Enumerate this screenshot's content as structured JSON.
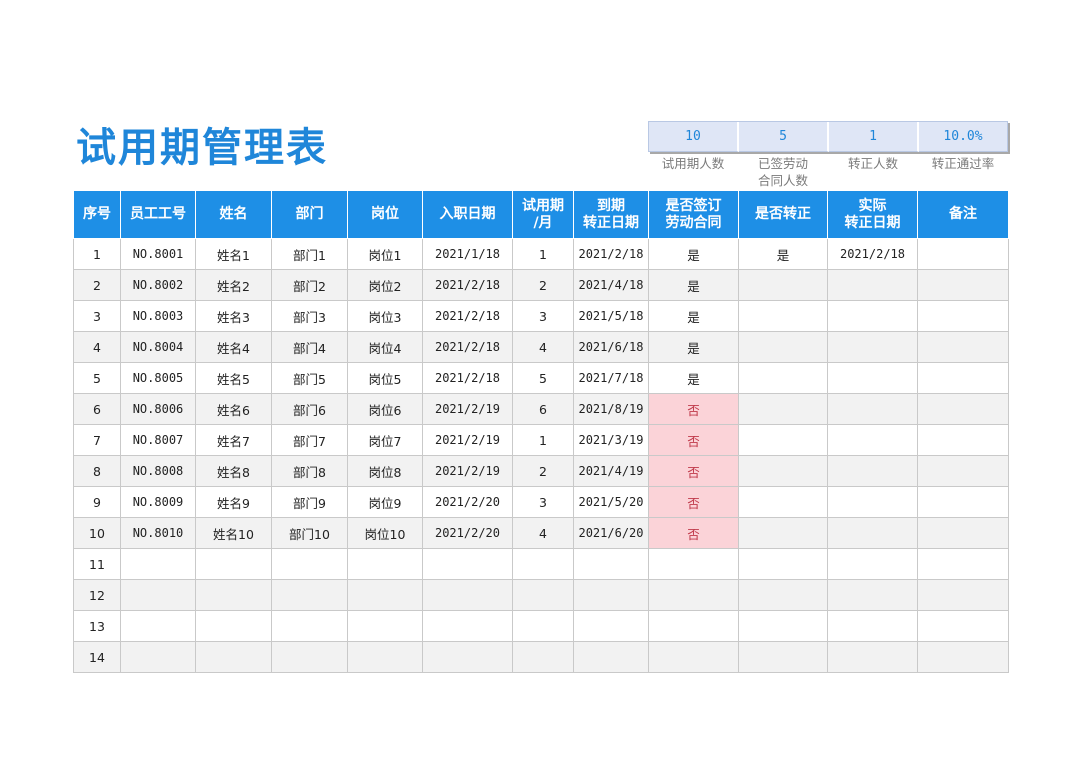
{
  "title": "试用期管理表",
  "stats": [
    {
      "value": "10",
      "label": "试用期人数"
    },
    {
      "value": "5",
      "label": "已签劳动\n合同人数"
    },
    {
      "value": "1",
      "label": "转正人数"
    },
    {
      "value": "10.0%",
      "label": "转正通过率"
    }
  ],
  "table": {
    "headers": [
      "序号",
      "员工工号",
      "姓名",
      "部门",
      "岗位",
      "入职日期",
      "试用期\n/月",
      "到期\n转正日期",
      "是否签订\n劳动合同",
      "是否转正",
      "实际\n转正日期",
      "备注"
    ],
    "rows": [
      [
        "1",
        "NO.8001",
        "姓名1",
        "部门1",
        "岗位1",
        "2021/1/18",
        "1",
        "2021/2/18",
        "是",
        "是",
        "2021/2/18",
        ""
      ],
      [
        "2",
        "NO.8002",
        "姓名2",
        "部门2",
        "岗位2",
        "2021/2/18",
        "2",
        "2021/4/18",
        "是",
        "",
        "",
        ""
      ],
      [
        "3",
        "NO.8003",
        "姓名3",
        "部门3",
        "岗位3",
        "2021/2/18",
        "3",
        "2021/5/18",
        "是",
        "",
        "",
        ""
      ],
      [
        "4",
        "NO.8004",
        "姓名4",
        "部门4",
        "岗位4",
        "2021/2/18",
        "4",
        "2021/6/18",
        "是",
        "",
        "",
        ""
      ],
      [
        "5",
        "NO.8005",
        "姓名5",
        "部门5",
        "岗位5",
        "2021/2/18",
        "5",
        "2021/7/18",
        "是",
        "",
        "",
        ""
      ],
      [
        "6",
        "NO.8006",
        "姓名6",
        "部门6",
        "岗位6",
        "2021/2/19",
        "6",
        "2021/8/19",
        "否",
        "",
        "",
        ""
      ],
      [
        "7",
        "NO.8007",
        "姓名7",
        "部门7",
        "岗位7",
        "2021/2/19",
        "1",
        "2021/3/19",
        "否",
        "",
        "",
        ""
      ],
      [
        "8",
        "NO.8008",
        "姓名8",
        "部门8",
        "岗位8",
        "2021/2/19",
        "2",
        "2021/4/19",
        "否",
        "",
        "",
        ""
      ],
      [
        "9",
        "NO.8009",
        "姓名9",
        "部门9",
        "岗位9",
        "2021/2/20",
        "3",
        "2021/5/20",
        "否",
        "",
        "",
        ""
      ],
      [
        "10",
        "NO.8010",
        "姓名10",
        "部门10",
        "岗位10",
        "2021/2/20",
        "4",
        "2021/6/20",
        "否",
        "",
        "",
        ""
      ],
      [
        "11",
        "",
        "",
        "",
        "",
        "",
        "",
        "",
        "",
        "",
        "",
        ""
      ],
      [
        "12",
        "",
        "",
        "",
        "",
        "",
        "",
        "",
        "",
        "",
        "",
        ""
      ],
      [
        "13",
        "",
        "",
        "",
        "",
        "",
        "",
        "",
        "",
        "",
        "",
        ""
      ],
      [
        "14",
        "",
        "",
        "",
        "",
        "",
        "",
        "",
        "",
        "",
        "",
        ""
      ]
    ]
  },
  "colors": {
    "accent": "#1e8fe6",
    "title": "#1f86d9",
    "stat_box": "#dfe6f6",
    "negative_fill": "#fbd3d8"
  }
}
